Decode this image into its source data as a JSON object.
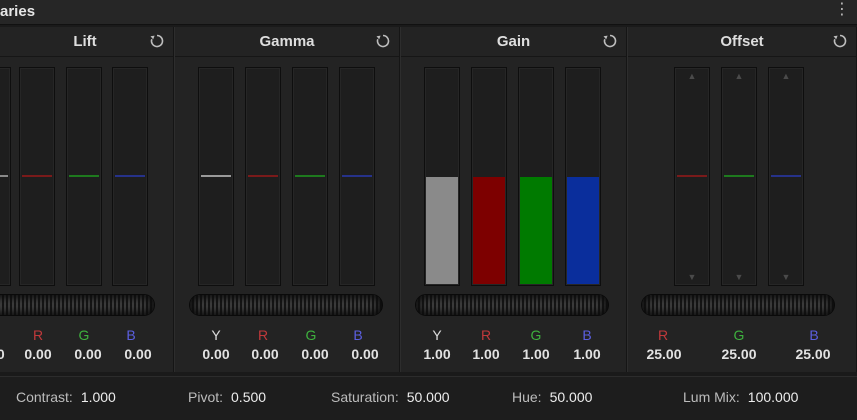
{
  "window": {
    "title": "aries"
  },
  "colors": {
    "red": "#c0393b",
    "green": "#3eb13e",
    "blue": "#5b5fe0",
    "gain_y": "#8a8a8a",
    "gain_r": "#7d0000",
    "gain_g": "#007a00",
    "gain_b": "#0a2e9c"
  },
  "panels": {
    "lift": {
      "title": "Lift",
      "labels": [
        "R",
        "G",
        "B"
      ],
      "values": [
        "0.00",
        "0.00",
        "0.00",
        "0.00"
      ]
    },
    "gamma": {
      "title": "Gamma",
      "labels": [
        "Y",
        "R",
        "G",
        "B"
      ],
      "values": [
        "0.00",
        "0.00",
        "0.00",
        "0.00"
      ]
    },
    "gain": {
      "title": "Gain",
      "labels": [
        "Y",
        "R",
        "G",
        "B"
      ],
      "values": [
        "1.00",
        "1.00",
        "1.00",
        "1.00"
      ],
      "fill_fraction": 0.5
    },
    "offset": {
      "title": "Offset",
      "labels": [
        "R",
        "G",
        "B"
      ],
      "values": [
        "25.00",
        "25.00",
        "25.00"
      ]
    }
  },
  "status": {
    "contrast_label": "Contrast:",
    "contrast_value": "1.000",
    "pivot_label": "Pivot:",
    "pivot_value": "0.500",
    "saturation_label": "Saturation:",
    "saturation_value": "50.000",
    "hue_label": "Hue:",
    "hue_value": "50.000",
    "lummix_label": "Lum Mix:",
    "lummix_value": "100.000"
  }
}
